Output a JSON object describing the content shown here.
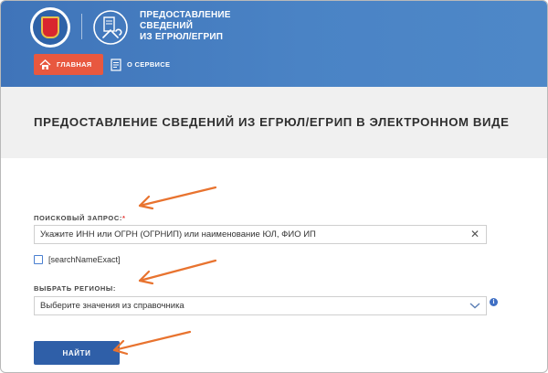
{
  "header": {
    "service_title_lines": [
      "ПРЕДОСТАВЛЕНИЕ",
      "СВЕДЕНИЙ",
      "ИЗ ЕГРЮЛ/ЕГРИП"
    ],
    "logo_icon": "fns-emblem-icon",
    "service_icon": "document-tools-icon",
    "colors": {
      "header_blue": "#4a83c5",
      "home_tab": "#e8583f"
    }
  },
  "nav": {
    "home_label": "ГЛАВНАЯ",
    "about_label": "О СЕРВИСЕ"
  },
  "page": {
    "title": "ПРЕДОСТАВЛЕНИЕ СВЕДЕНИЙ ИЗ ЕГРЮЛ/ЕГРИП В ЭЛЕКТРОННОМ ВИДЕ"
  },
  "form": {
    "query_label": "ПОИСКОВЫЙ ЗАПРОС:",
    "required_mark": "*",
    "query_placeholder": "Укажите ИНН или ОГРН (ОГРНИП) или наименование ЮЛ, ФИО ИП",
    "exact_checkbox_label": "[searchNameExact]",
    "region_label": "ВЫБРАТЬ РЕГИОНЫ:",
    "region_placeholder": "Выберите значения из справочника",
    "submit_label": "НАЙТИ",
    "colors": {
      "button": "#2f5fa8",
      "required": "#e53935",
      "annotation_arrow": "#e8732f"
    }
  }
}
